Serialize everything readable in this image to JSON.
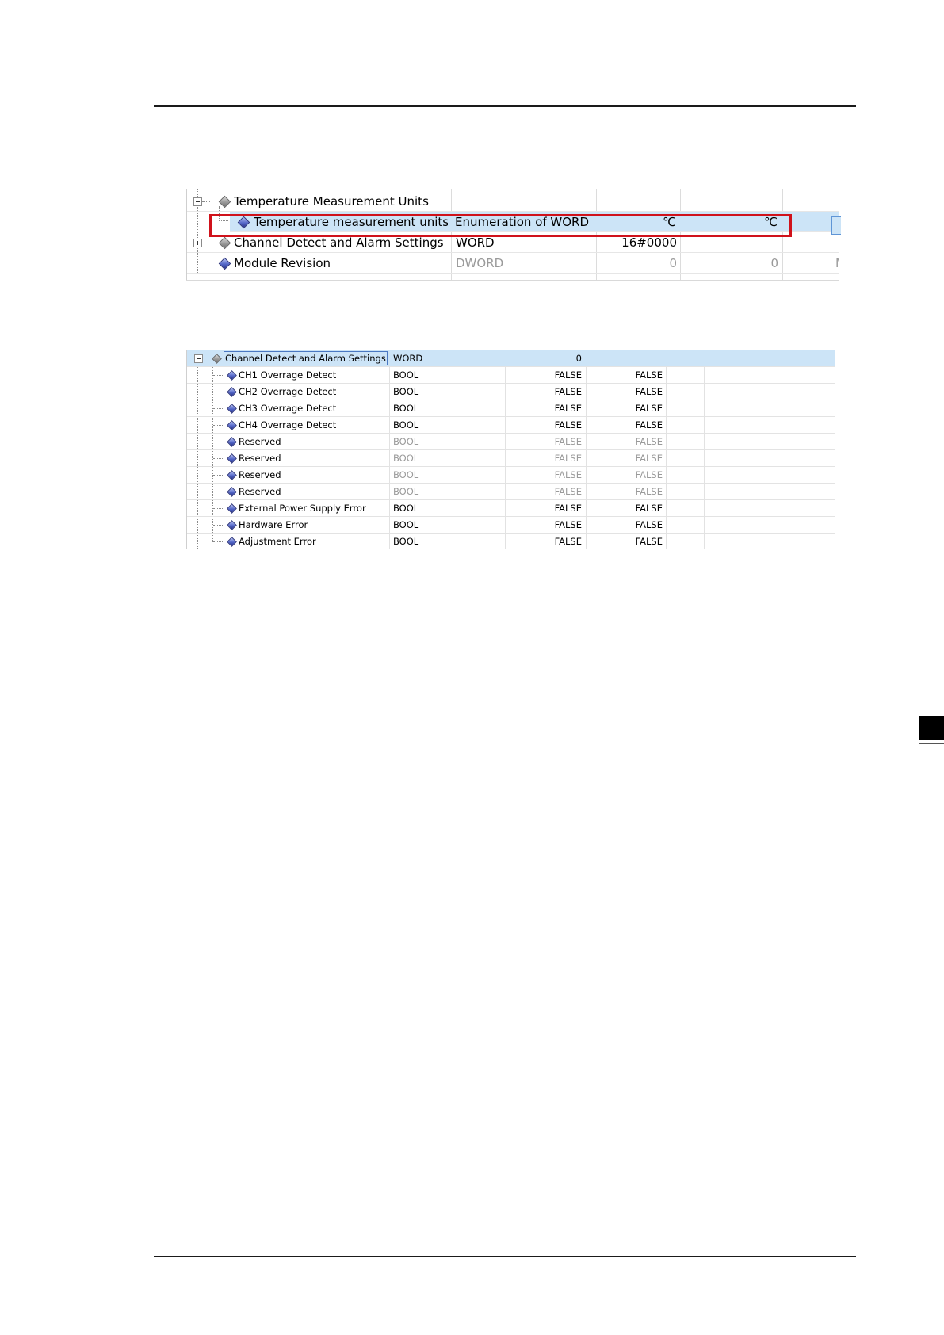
{
  "grid_top": {
    "rows": [
      {
        "name": "Temperature Measurement Units",
        "type": "",
        "default": "",
        "current": ""
      },
      {
        "name": "Temperature measurement units",
        "type": "Enumeration of WORD",
        "default": "℃",
        "current": "℃"
      },
      {
        "name": "Channel Detect and Alarm Settings",
        "type": "WORD",
        "default": "16#0000",
        "current": ""
      },
      {
        "name": "Module Revision",
        "type": "DWORD",
        "default": "0",
        "current": "0",
        "extra": "M"
      }
    ]
  },
  "grid_bottom": {
    "rows": [
      {
        "name": "Channel Detect and Alarm Settings",
        "type": "WORD",
        "default": "0",
        "current": ""
      },
      {
        "name": "CH1 Overrage Detect",
        "type": "BOOL",
        "default": "FALSE",
        "current": "FALSE"
      },
      {
        "name": "CH2 Overrage Detect",
        "type": "BOOL",
        "default": "FALSE",
        "current": "FALSE"
      },
      {
        "name": "CH3 Overrage Detect",
        "type": "BOOL",
        "default": "FALSE",
        "current": "FALSE"
      },
      {
        "name": "CH4 Overrage Detect",
        "type": "BOOL",
        "default": "FALSE",
        "current": "FALSE"
      },
      {
        "name": "Reserved",
        "type": "BOOL",
        "default": "FALSE",
        "current": "FALSE"
      },
      {
        "name": "Reserved",
        "type": "BOOL",
        "default": "FALSE",
        "current": "FALSE"
      },
      {
        "name": "Reserved",
        "type": "BOOL",
        "default": "FALSE",
        "current": "FALSE"
      },
      {
        "name": "Reserved",
        "type": "BOOL",
        "default": "FALSE",
        "current": "FALSE"
      },
      {
        "name": "External Power Supply Error",
        "type": "BOOL",
        "default": "FALSE",
        "current": "FALSE"
      },
      {
        "name": "Hardware Error",
        "type": "BOOL",
        "default": "FALSE",
        "current": "FALSE"
      },
      {
        "name": "Adjustment Error",
        "type": "BOOL",
        "default": "FALSE",
        "current": "FALSE"
      }
    ]
  },
  "colors": {
    "selection": "#cce4f7",
    "highlight_border": "#d0121b",
    "muted_text": "#9a9a9a"
  }
}
